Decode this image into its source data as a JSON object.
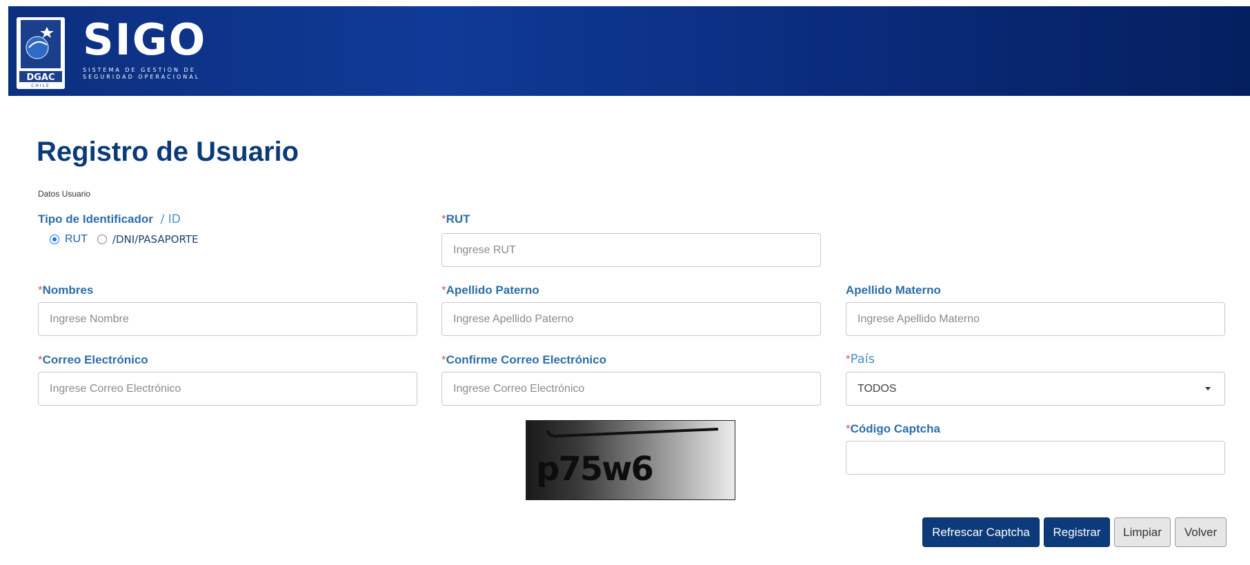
{
  "header": {
    "logo_text": "DGAC",
    "logo_subtext": "CHILE",
    "brand": "SIGO",
    "brand_subtitle_line1": "SISTEMA DE GESTIÓN DE",
    "brand_subtitle_line2": "SEGURIDAD OPERACIONAL"
  },
  "page": {
    "title": "Registro de Usuario",
    "section_label": "Datos Usuario"
  },
  "form": {
    "id_type": {
      "label": "Tipo de Identificador",
      "label_suffix": "/ ID",
      "options": [
        "RUT",
        "/DNI/PASAPORTE"
      ],
      "selected": "RUT"
    },
    "rut": {
      "label": "RUT",
      "placeholder": "Ingrese RUT"
    },
    "nombres": {
      "label": "Nombres",
      "placeholder": "Ingrese Nombre"
    },
    "apellido_paterno": {
      "label": "Apellido Paterno",
      "placeholder": "Ingrese Apellido Paterno"
    },
    "apellido_materno": {
      "label": "Apellido Materno",
      "placeholder": "Ingrese Apellido Materno"
    },
    "correo": {
      "label": "Correo Electrónico",
      "placeholder": "Ingrese Correo Electrónico"
    },
    "confirme_correo": {
      "label": "Confirme Correo Electrónico",
      "placeholder": "Ingrese Correo Electrónico"
    },
    "pais": {
      "label": "País",
      "value": "TODOS"
    },
    "captcha": {
      "label": "Código Captcha",
      "image_text": "p75w6",
      "value": ""
    }
  },
  "buttons": {
    "refresh": "Refrescar Captcha",
    "register": "Registrar",
    "clear": "Limpiar",
    "back": "Volver"
  },
  "colors": {
    "header_bg": "#0f3a97",
    "title": "#0b3a78",
    "label": "#2c6da6",
    "required": "#d9534f",
    "primary_button": "#0c3a7a"
  }
}
